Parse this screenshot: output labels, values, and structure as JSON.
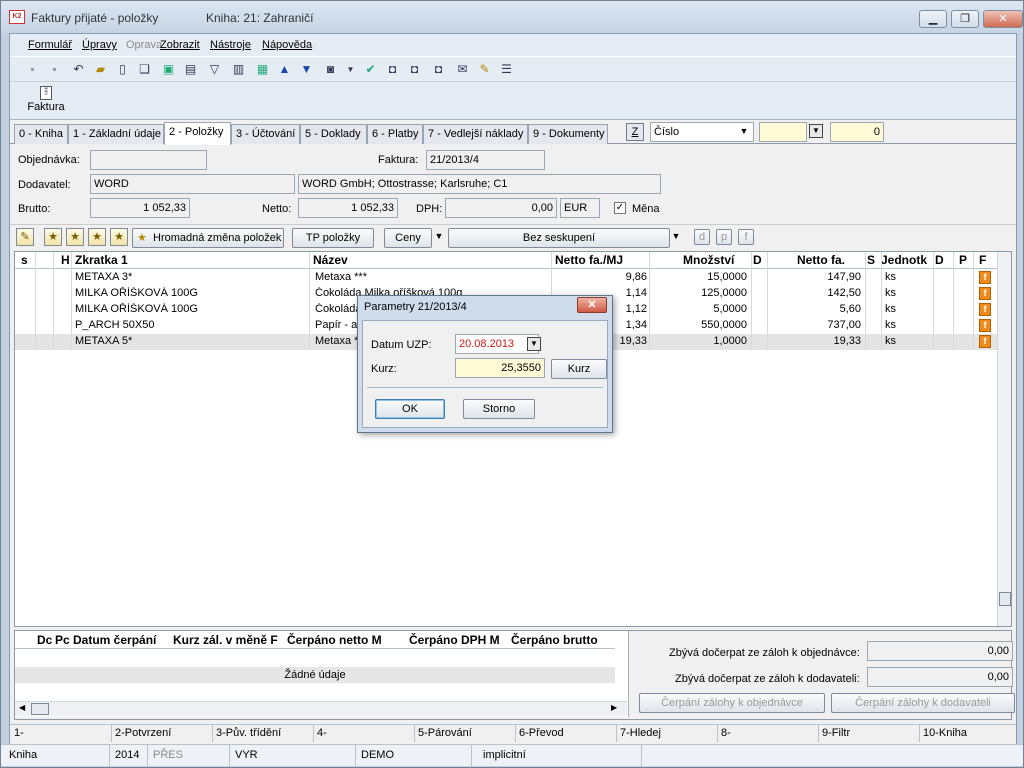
{
  "window": {
    "title": "Faktury přijaté - položky",
    "book": "Kniha: 21: Zahraničí"
  },
  "menu": [
    {
      "label": "Formulář",
      "disabled": false
    },
    {
      "label": "Úpravy",
      "disabled": false
    },
    {
      "label": "Oprava",
      "disabled": true
    },
    {
      "label": "Zobrazit",
      "disabled": false
    },
    {
      "label": "Nástroje",
      "disabled": false
    },
    {
      "label": "Nápověda",
      "disabled": false
    }
  ],
  "toolbar2": {
    "faktura_label": "Faktura"
  },
  "tabs": [
    "0 - Kniha",
    "1 - Základní údaje",
    "2 - Položky",
    "3 - Účtování",
    "5 - Doklady",
    "6 - Platby",
    "7 - Vedlejší náklady",
    "9 - Dokumenty"
  ],
  "search": {
    "z_label": "Z",
    "field": "Číslo",
    "value": "0"
  },
  "header": {
    "objednavka_label": "Objednávka:",
    "objednavka": "",
    "faktura_label": "Faktura:",
    "faktura": "21/2013/4",
    "dodavatel_label": "Dodavatel:",
    "dodavatel_code": "WORD",
    "dodavatel_name": "WORD GmbH; Ottostrasse; Karlsruhe; C1",
    "brutto_label": "Brutto:",
    "brutto": "1 052,33",
    "netto_label": "Netto:",
    "netto": "1 052,33",
    "dph_label": "DPH:",
    "dph": "0,00",
    "currency": "EUR",
    "mena_label": "Měna",
    "mena_checked": "✓"
  },
  "grid_toolbar": {
    "hromadna": "Hromadná změna položek",
    "tp": "TP položky",
    "ceny": "Ceny",
    "seskupeni": "Bez seskupení",
    "icons": [
      "d",
      "p",
      "f"
    ]
  },
  "columns": [
    "s",
    "H",
    "Zkratka 1",
    "Název",
    "Netto fa./MJ",
    "Množství",
    "D",
    "Netto fa.",
    "S",
    "Jednotk",
    "D",
    "P",
    "F"
  ],
  "rows": [
    {
      "zkratka": "METAXA 3*",
      "nazev": "Metaxa ***",
      "netto_mj": "9,86",
      "mnozstvi": "15,0000",
      "netto": "147,90",
      "jednotka": "ks",
      "f": "f"
    },
    {
      "zkratka": "MILKA OŘÍŠKOVÁ 100G",
      "nazev": "Čokoláda Milka oříšková 100g",
      "netto_mj": "1,14",
      "mnozstvi": "125,0000",
      "netto": "142,50",
      "jednotka": "ks",
      "f": "f"
    },
    {
      "zkratka": "MILKA OŘÍŠKOVÁ 100G",
      "nazev": "Čokoláda",
      "netto_mj": "1,12",
      "mnozstvi": "5,0000",
      "netto": "5,60",
      "jednotka": "ks",
      "f": "f"
    },
    {
      "zkratka": "P_ARCH 50X50",
      "nazev": "Papír - ar",
      "netto_mj": "1,34",
      "mnozstvi": "550,0000",
      "netto": "737,00",
      "jednotka": "ks",
      "f": "f"
    },
    {
      "zkratka": "METAXA 5*",
      "nazev": "Metaxa *",
      "netto_mj": "19,33",
      "mnozstvi": "1,0000",
      "netto": "19,33",
      "jednotka": "ks",
      "f": "f"
    }
  ],
  "bottom_grid": {
    "columns": [
      "Dc",
      "Pc",
      "Datum čerpání",
      "Kurz zál. v měně F",
      "Čerpáno netto M",
      "Čerpáno DPH M",
      "Čerpáno brutto"
    ],
    "empty": "Žádné údaje"
  },
  "advances": {
    "objednavka_label": "Zbývá dočerpat ze záloh k objednávce:",
    "objednavka_value": "0,00",
    "dodavatel_label": "Zbývá dočerpat ze záloh k dodavateli:",
    "dodavatel_value": "0,00",
    "btn_objednavka": "Čerpání zálohy k objednávce",
    "btn_dodavatel": "Čerpání zálohy k dodavateli"
  },
  "fkeys": [
    "1-",
    "2-Potvrzení",
    "3-Pův. třídění",
    "4-",
    "5-Párování",
    "6-Převod",
    "7-Hledej",
    "8-",
    "9-Filtr",
    "10-Kniha"
  ],
  "status": [
    "Kniha",
    "2014",
    "PŘES",
    "VYR",
    "DEMO",
    "implicitní"
  ],
  "dialog": {
    "title": "Parametry 21/2013/4",
    "datum_label": "Datum UZP:",
    "datum": "20.08.2013",
    "kurz_label": "Kurz:",
    "kurz": "25,3550",
    "kurz_btn": "Kurz",
    "ok": "OK",
    "storno": "Storno"
  }
}
